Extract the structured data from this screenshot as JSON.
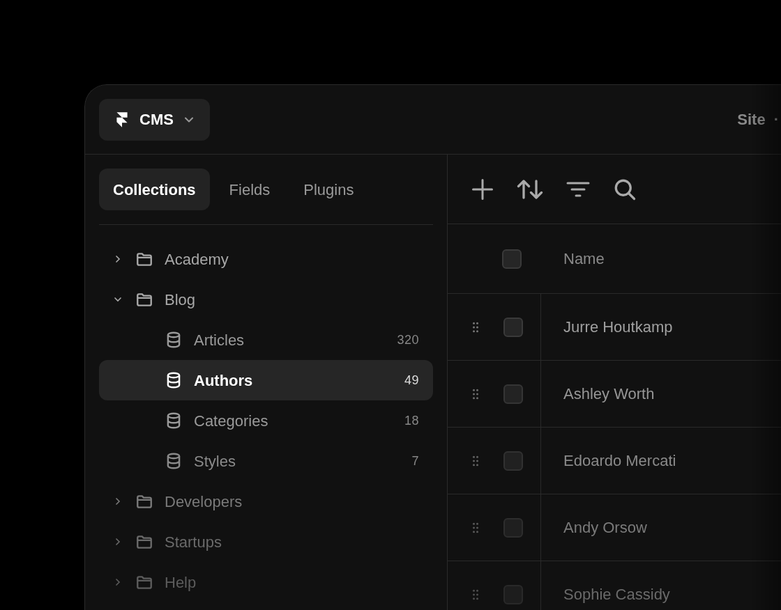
{
  "header": {
    "app_menu": {
      "label": "CMS"
    },
    "site": {
      "label": "Site",
      "separator": "·"
    }
  },
  "tabs": [
    {
      "label": "Collections",
      "selected": true
    },
    {
      "label": "Fields",
      "selected": false
    },
    {
      "label": "Plugins",
      "selected": false
    }
  ],
  "tree": [
    {
      "label": "Academy",
      "kind": "folder",
      "expanded": false,
      "selected": false
    },
    {
      "label": "Blog",
      "kind": "folder",
      "expanded": true,
      "selected": false,
      "children": [
        {
          "label": "Articles",
          "kind": "collection",
          "count": "320",
          "selected": false
        },
        {
          "label": "Authors",
          "kind": "collection",
          "count": "49",
          "selected": true
        },
        {
          "label": "Categories",
          "kind": "collection",
          "count": "18",
          "selected": false
        },
        {
          "label": "Styles",
          "kind": "collection",
          "count": "7",
          "selected": false
        }
      ]
    },
    {
      "label": "Developers",
      "kind": "folder",
      "expanded": false,
      "selected": false
    },
    {
      "label": "Startups",
      "kind": "folder",
      "expanded": false,
      "selected": false
    },
    {
      "label": "Help",
      "kind": "folder",
      "expanded": false,
      "selected": false
    }
  ],
  "table": {
    "columns": [
      "Name"
    ],
    "select_all": {
      "checked": false
    },
    "rows": [
      {
        "name": "Jurre Houtkamp",
        "checked": false
      },
      {
        "name": "Ashley Worth",
        "checked": false
      },
      {
        "name": "Edoardo Mercati",
        "checked": false
      },
      {
        "name": "Andy Orsow",
        "checked": false
      },
      {
        "name": "Sophie Cassidy",
        "checked": false
      }
    ]
  }
}
